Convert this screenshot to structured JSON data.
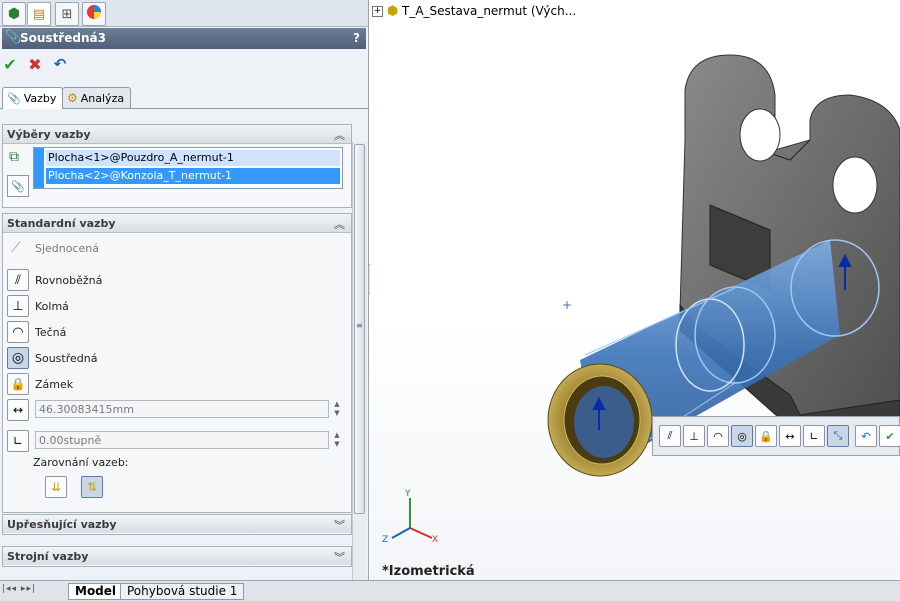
{
  "panel": {
    "title": "Soustředná3",
    "help": "?",
    "tabs": {
      "mates": "Vazby",
      "analysis": "Analýza"
    },
    "selections": {
      "heading": "Výběry vazby",
      "items": [
        "Plocha<1>@Pouzdro_A_nermut-1",
        "Plocha<2>@Konzola_T_nermut-1"
      ]
    },
    "standard": {
      "heading": "Standardní vazby",
      "coincident": "Sjednocená",
      "parallel": "Rovnoběžná",
      "perpendicular": "Kolmá",
      "tangent": "Tečná",
      "concentric": "Soustředná",
      "lock": "Zámek",
      "distance_value": "46.30083415mm",
      "angle_value": "0.00stupně",
      "alignment_label": "Zarovnání vazeb:"
    },
    "advanced": {
      "heading": "Upřesňující vazby"
    },
    "mechanical": {
      "heading": "Strojní vazby"
    }
  },
  "viewport": {
    "tree_root": "T_A_Sestava_nermut  (Vých...",
    "view_name": "*Izometrická",
    "triad": {
      "x": "X",
      "y": "Y",
      "z": "Z"
    }
  },
  "bottom_tabs": [
    "Model",
    "Pohybová studie 1"
  ],
  "colors": {
    "accent": "#3399ff",
    "title": "#5a6c85",
    "part_gray": "#6b6b6b",
    "part_blue": "#4f86c6",
    "part_bronze": "#b49a3a"
  }
}
